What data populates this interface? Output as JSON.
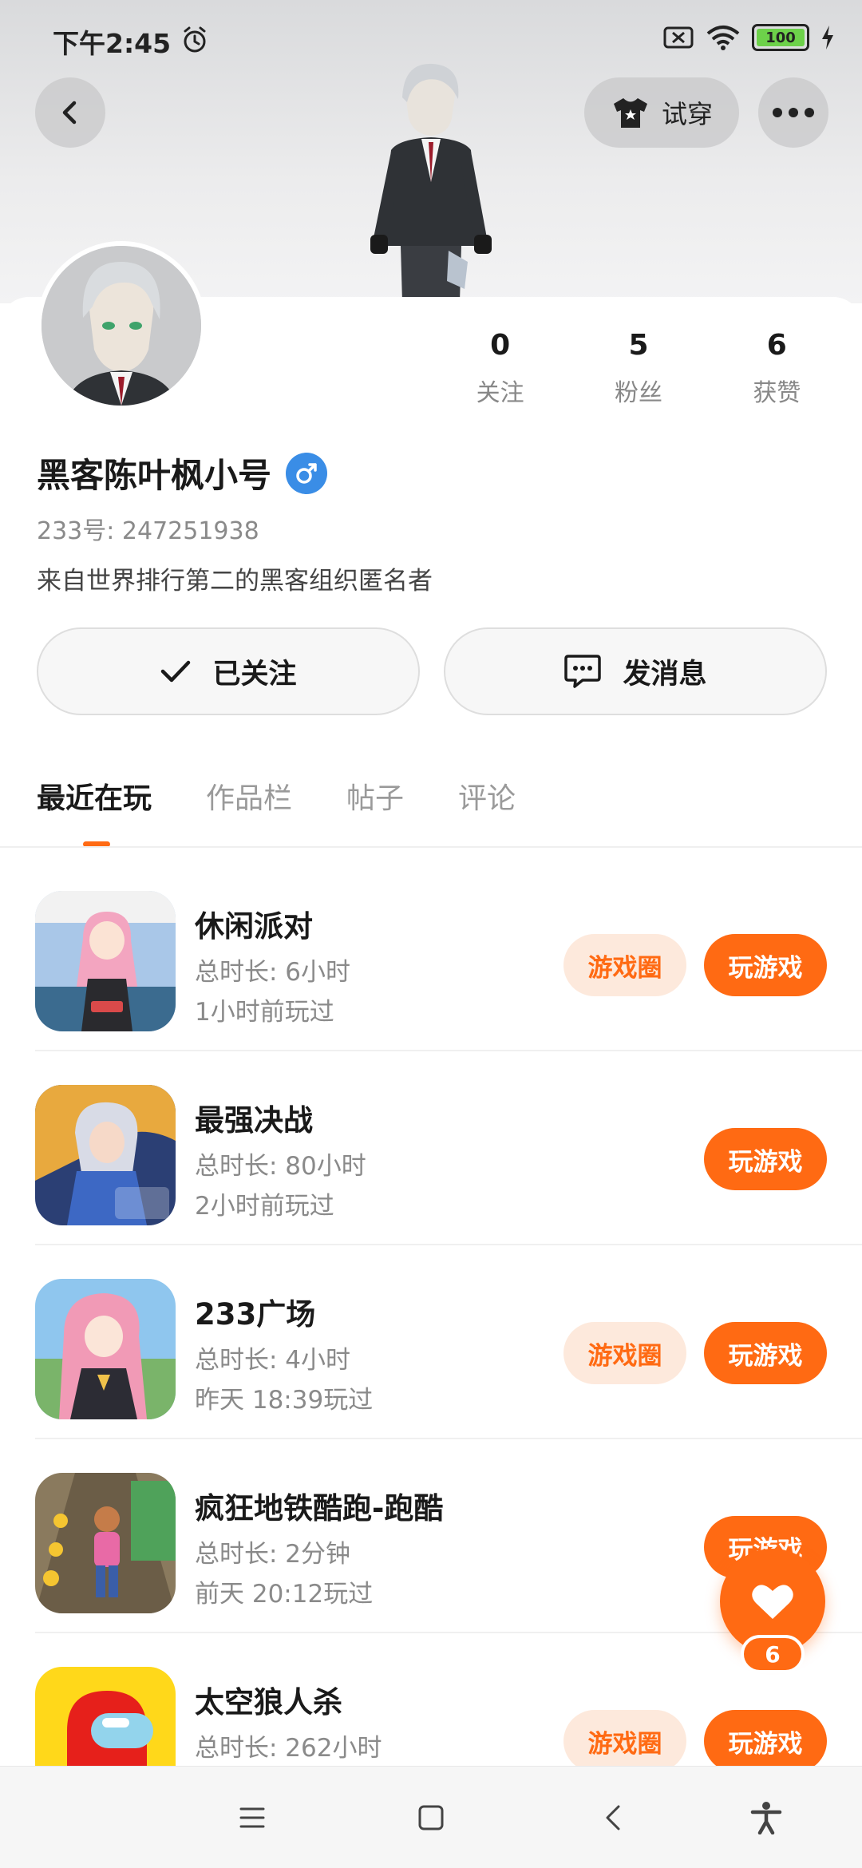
{
  "status_bar": {
    "time": "下午2:45",
    "battery": "100"
  },
  "header": {
    "try_on_label": "试穿"
  },
  "profile": {
    "stats": [
      {
        "value": "0",
        "label": "关注"
      },
      {
        "value": "5",
        "label": "粉丝"
      },
      {
        "value": "6",
        "label": "获赞"
      }
    ],
    "nickname": "黑客陈叶枫小号",
    "gender": "male",
    "uid": "233号: 247251938",
    "bio": "来自世界排行第二的黑客组织匿名者",
    "follow_label": "已关注",
    "message_label": "发消息"
  },
  "tabs": [
    {
      "label": "最近在玩",
      "active": true
    },
    {
      "label": "作品栏",
      "active": false
    },
    {
      "label": "帖子",
      "active": false
    },
    {
      "label": "评论",
      "active": false
    }
  ],
  "games": [
    {
      "name": "休闲派对",
      "duration": "总时长: 6小时",
      "last_played": "1小时前玩过",
      "circle_label": "游戏圈",
      "play_label": "玩游戏",
      "has_circle": true
    },
    {
      "name": "最强决战",
      "duration": "总时长: 80小时",
      "last_played": "2小时前玩过",
      "circle_label": "",
      "play_label": "玩游戏",
      "has_circle": false
    },
    {
      "name": "233广场",
      "duration": "总时长: 4小时",
      "last_played": "昨天 18:39玩过",
      "circle_label": "游戏圈",
      "play_label": "玩游戏",
      "has_circle": true
    },
    {
      "name": "疯狂地铁酷跑-跑酷",
      "duration": "总时长: 2分钟",
      "last_played": "前天 20:12玩过",
      "circle_label": "",
      "play_label": "玩游戏",
      "has_circle": false
    },
    {
      "name": "太空狼人杀",
      "duration": "总时长: 262小时",
      "last_played": "",
      "circle_label": "游戏圈",
      "play_label": "玩游戏",
      "has_circle": true
    }
  ],
  "like_fab": {
    "count": "6"
  },
  "colors": {
    "accent": "#ff6a13",
    "accent_light": "#fde9dc",
    "gender_male": "#3a8de6"
  }
}
